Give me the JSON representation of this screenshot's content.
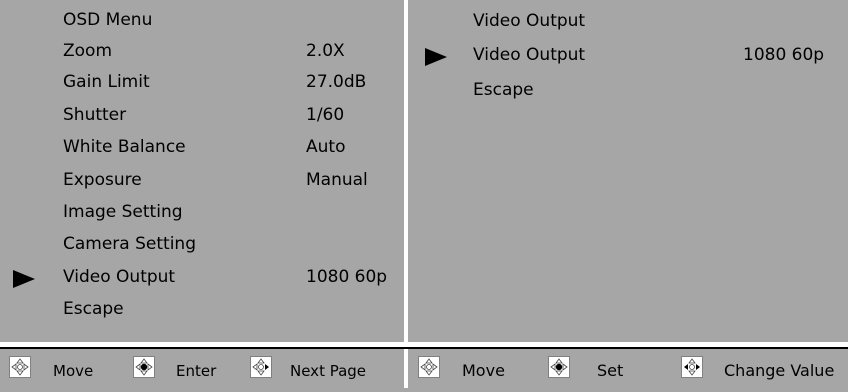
{
  "left_menu": {
    "items": [
      {
        "label": "OSD Menu",
        "value": ""
      },
      {
        "label": "Zoom",
        "value": "2.0X"
      },
      {
        "label": "Gain Limit",
        "value": "27.0dB"
      },
      {
        "label": "Shutter",
        "value": "1/60"
      },
      {
        "label": "White Balance",
        "value": "Auto"
      },
      {
        "label": "Exposure",
        "value": "Manual"
      },
      {
        "label": "Image Setting",
        "value": ""
      },
      {
        "label": "Camera Setting",
        "value": ""
      },
      {
        "label": "Video Output",
        "value": "1080 60p"
      },
      {
        "label": "Escape",
        "value": ""
      }
    ],
    "selected_index": 8
  },
  "right_menu": {
    "items": [
      {
        "label": "Video Output",
        "value": ""
      },
      {
        "label": "Video Output",
        "value": "1080 60p"
      },
      {
        "label": "Escape",
        "value": ""
      }
    ],
    "selected_index": 1
  },
  "footer": {
    "left": [
      {
        "icon": "dpad-move-icon",
        "label": "Move"
      },
      {
        "icon": "dpad-enter-icon",
        "label": "Enter"
      },
      {
        "icon": "dpad-next-page-icon",
        "label": "Next Page"
      }
    ],
    "right": [
      {
        "icon": "dpad-move-icon",
        "label": "Move"
      },
      {
        "icon": "dpad-set-icon",
        "label": "Set"
      },
      {
        "icon": "dpad-change-value-icon",
        "label": "Change Value"
      }
    ]
  },
  "colors": {
    "background": "#a6a6a6",
    "text": "#000000",
    "divider": "#ffffff"
  }
}
